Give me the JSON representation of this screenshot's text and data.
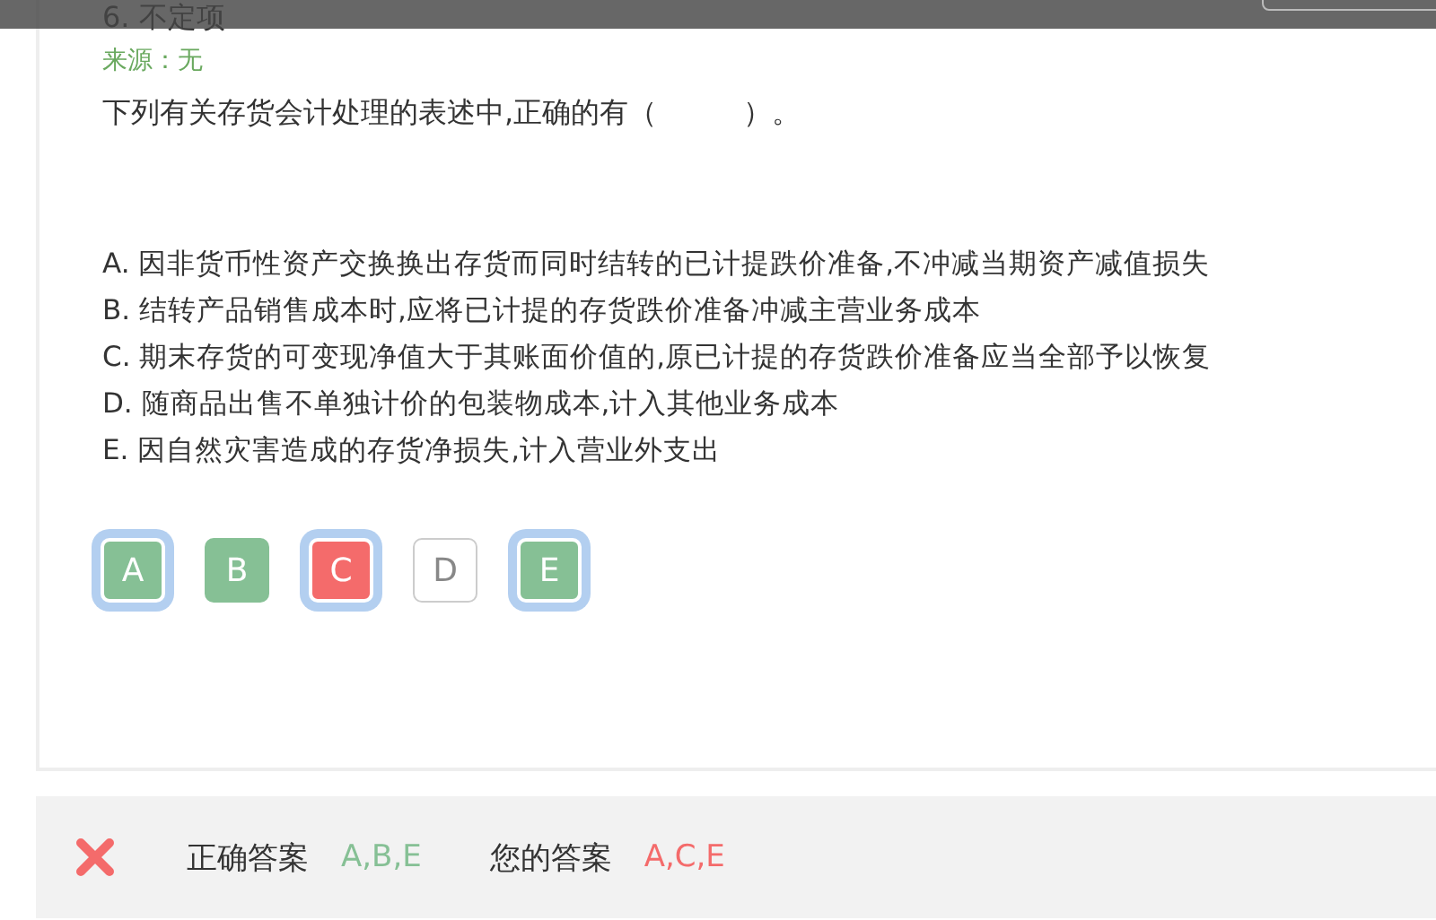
{
  "question": {
    "number_title": "6. 不定项",
    "source": "来源：无",
    "stem": "下列有关存货会计处理的表述中,正确的有（　　　）。",
    "options": [
      {
        "text": "A. 因非货币性资产交换换出存货而同时结转的已计提跌价准备,不冲减当期资产减值损失"
      },
      {
        "text": "B. 结转产品销售成本时,应将已计提的存货跌价准备冲减主营业务成本"
      },
      {
        "text": "C. 期末存货的可变现净值大于其账面价值的,原已计提的存货跌价准备应当全部予以恢复"
      },
      {
        "text": "D. 随商品出售不单独计价的包装物成本,计入其他业务成本"
      },
      {
        "text": "E. 因自然灾害造成的存货净损失,计入营业外支出"
      }
    ],
    "choices": [
      {
        "letter": "A",
        "correct": true,
        "selected": true
      },
      {
        "letter": "B",
        "correct": true,
        "selected": false
      },
      {
        "letter": "C",
        "correct": false,
        "selected": true
      },
      {
        "letter": "D",
        "correct": false,
        "selected": false
      },
      {
        "letter": "E",
        "correct": true,
        "selected": true
      }
    ]
  },
  "result": {
    "correct": false,
    "correct_label": "正确答案",
    "correct_answer": "A,B,E",
    "your_label": "您的答案",
    "your_answer": "A,C,E"
  }
}
